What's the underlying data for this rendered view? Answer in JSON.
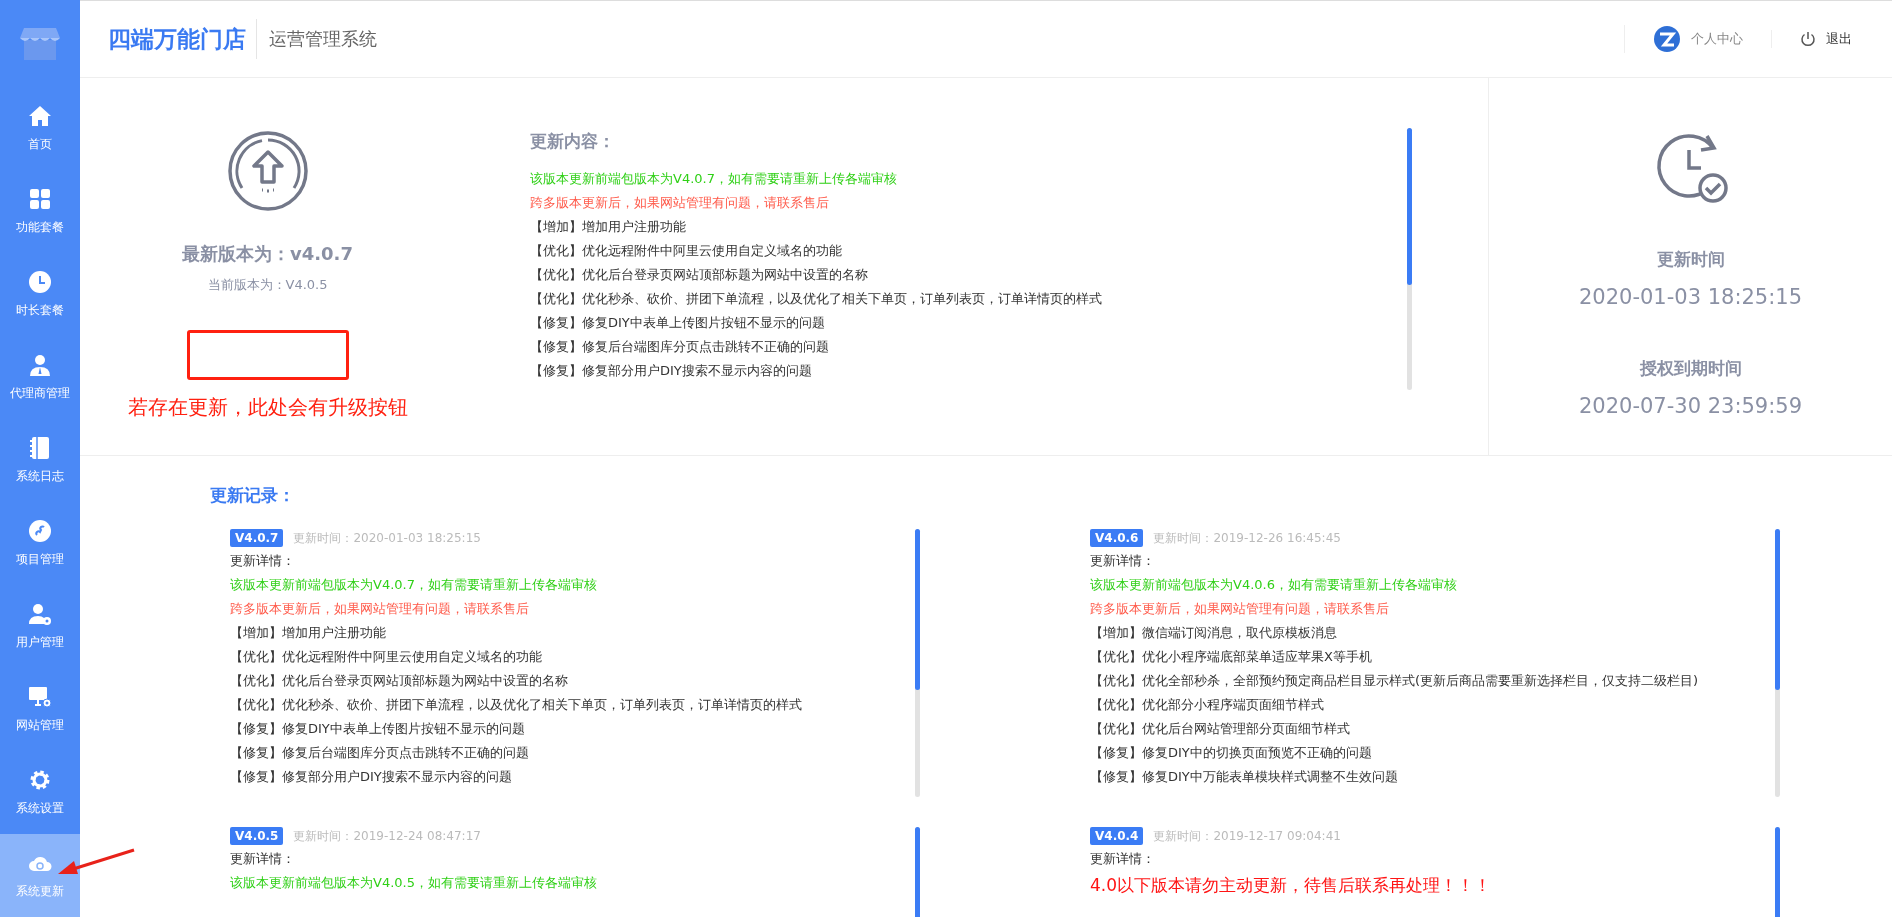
{
  "sidebar": {
    "items": [
      {
        "kind": "home",
        "label": "首页",
        "selected": false
      },
      {
        "kind": "grid",
        "label": "功能套餐",
        "selected": false
      },
      {
        "kind": "clock",
        "label": "时长套餐",
        "selected": false
      },
      {
        "kind": "agent",
        "label": "代理商管理",
        "selected": false
      },
      {
        "kind": "notebook",
        "label": "系统日志",
        "selected": false
      },
      {
        "kind": "link",
        "label": "项目管理",
        "selected": false
      },
      {
        "kind": "user",
        "label": "用户管理",
        "selected": false
      },
      {
        "kind": "monitor",
        "label": "网站管理",
        "selected": false
      },
      {
        "kind": "gear",
        "label": "系统设置",
        "selected": false
      },
      {
        "kind": "cloud",
        "label": "系统更新",
        "selected": true
      }
    ]
  },
  "header": {
    "brand": "四端万能门店",
    "subtitle": "运营管理系统",
    "links": [
      {
        "kind": "profile",
        "label": "个人中心"
      },
      {
        "kind": "logout",
        "label": "退出"
      }
    ]
  },
  "version_panel": {
    "latest": "最新版本为：v4.0.7",
    "current": "当前版本为：V4.0.5",
    "upgrade_note": "若存在更新，此处会有升级按钮"
  },
  "update_content": {
    "title": "更新内容：",
    "lines": [
      {
        "kind": "note",
        "text": "该版本更新前端包版本为V4.0.7，如有需要请重新上传各端审核"
      },
      {
        "kind": "warning",
        "text": "跨多版本更新后，如果网站管理有问题，请联系售后"
      },
      {
        "kind": "change",
        "text": "【增加】增加用户注册功能"
      },
      {
        "kind": "change",
        "text": "【优化】优化远程附件中阿里云使用自定义域名的功能"
      },
      {
        "kind": "change",
        "text": "【优化】优化后台登录页网站顶部标题为网站中设置的名称"
      },
      {
        "kind": "change",
        "text": "【优化】优化秒杀、砍价、拼团下单流程，以及优化了相关下单页，订单列表页，订单详情页的样式"
      },
      {
        "kind": "change",
        "text": "【修复】修复DIY中表单上传图片按钮不显示的问题"
      },
      {
        "kind": "change",
        "text": "【修复】修复后台端图库分页点击跳转不正确的问题"
      },
      {
        "kind": "change",
        "text": "【修复】修复部分用户DIY搜索不显示内容的问题"
      }
    ]
  },
  "time_panel": {
    "update_label": "更新时间",
    "update_time": "2020-01-03 18:25:15",
    "expiry_label": "授权到期时间",
    "expiry_time": "2020-07-30 23:59:59"
  },
  "records": {
    "title": "更新记录：",
    "items": [
      {
        "version": "V4.0.7",
        "time": "更新时间：2020-01-03 18:25:15",
        "details_label": "更新详情：",
        "lines": [
          {
            "kind": "note",
            "text": "该版本更新前端包版本为V4.0.7，如有需要请重新上传各端审核"
          },
          {
            "kind": "warning",
            "text": "跨多版本更新后，如果网站管理有问题，请联系售后"
          },
          {
            "kind": "change",
            "text": "【增加】增加用户注册功能"
          },
          {
            "kind": "change",
            "text": "【优化】优化远程附件中阿里云使用自定义域名的功能"
          },
          {
            "kind": "change",
            "text": "【优化】优化后台登录页网站顶部标题为网站中设置的名称"
          },
          {
            "kind": "change",
            "text": "【优化】优化秒杀、砍价、拼团下单流程，以及优化了相关下单页，订单列表页，订单详情页的样式"
          },
          {
            "kind": "change",
            "text": "【修复】修复DIY中表单上传图片按钮不显示的问题"
          },
          {
            "kind": "change",
            "text": "【修复】修复后台端图库分页点击跳转不正确的问题"
          },
          {
            "kind": "change",
            "text": "【修复】修复部分用户DIY搜索不显示内容的问题"
          }
        ]
      },
      {
        "version": "V4.0.6",
        "time": "更新时间：2019-12-26 16:45:45",
        "details_label": "更新详情：",
        "lines": [
          {
            "kind": "note",
            "text": "该版本更新前端包版本为V4.0.6，如有需要请重新上传各端审核"
          },
          {
            "kind": "warning",
            "text": "跨多版本更新后，如果网站管理有问题，请联系售后"
          },
          {
            "kind": "change",
            "text": "【增加】微信端订阅消息，取代原模板消息"
          },
          {
            "kind": "change",
            "text": "【优化】优化小程序端底部菜单适应苹果X等手机"
          },
          {
            "kind": "change",
            "text": "【优化】优化全部秒杀，全部预约预定商品栏目显示样式(更新后商品需要重新选择栏目，仅支持二级栏目)"
          },
          {
            "kind": "change",
            "text": "【优化】优化部分小程序端页面细节样式"
          },
          {
            "kind": "change",
            "text": "【优化】优化后台网站管理部分页面细节样式"
          },
          {
            "kind": "change",
            "text": "【修复】修复DIY中的切换页面预览不正确的问题"
          },
          {
            "kind": "change",
            "text": "【修复】修复DIY中万能表单模块样式调整不生效问题"
          }
        ]
      },
      {
        "version": "V4.0.5",
        "time": "更新时间：2019-12-24 08:47:17",
        "details_label": "更新详情：",
        "lines": [
          {
            "kind": "note",
            "text": "该版本更新前端包版本为V4.0.5，如有需要请重新上传各端审核"
          }
        ]
      },
      {
        "version": "V4.0.4",
        "time": "更新时间：2019-12-17 09:04:41",
        "details_label": "更新详情：",
        "lines": [
          {
            "kind": "alert",
            "text": "4.0以下版本请勿主动更新，待售后联系再处理！！！"
          }
        ]
      }
    ]
  }
}
